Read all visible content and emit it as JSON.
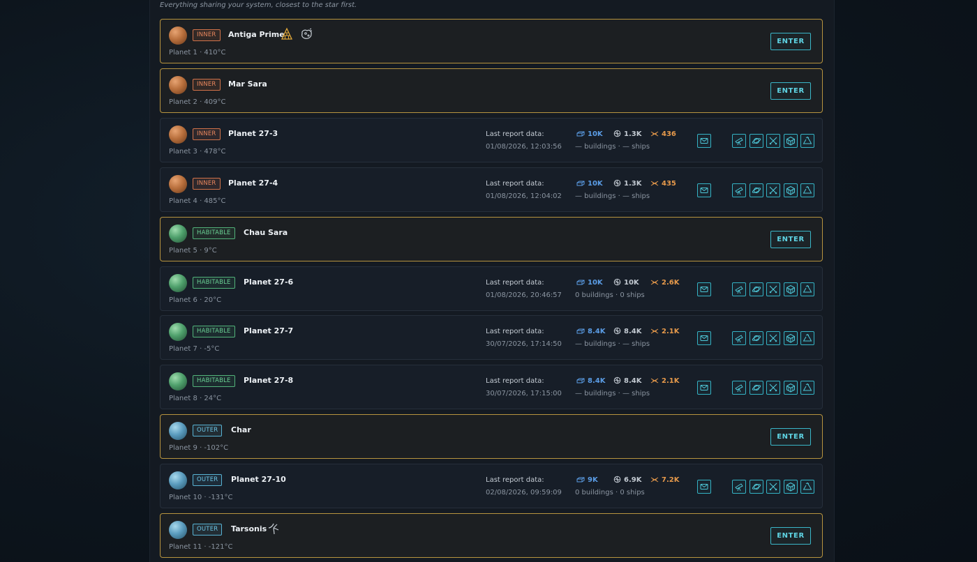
{
  "subtitle": "Everything sharing your system, closest to the star first.",
  "labels": {
    "enter": "ENTER",
    "last_report": "Last report data:"
  },
  "planets": [
    {
      "zone": "INNER",
      "name": "Antiga Prime",
      "sub": "Planet 1 · 410°C",
      "owned": true,
      "icons": [
        "pyramid-structure-icon",
        "asteroid-icon"
      ]
    },
    {
      "zone": "INNER",
      "name": "Mar Sara",
      "sub": "Planet 2 · 409°C",
      "owned": true
    },
    {
      "zone": "INNER",
      "name": "Planet 27-3",
      "sub": "Planet 3 · 478°C",
      "owned": false,
      "date": "01/08/2026, 12:03:56",
      "metal": "10K",
      "crystal": "1.3K",
      "fuel": "436",
      "bs": "— buildings · — ships"
    },
    {
      "zone": "INNER",
      "name": "Planet 27-4",
      "sub": "Planet 4 · 485°C",
      "owned": false,
      "date": "01/08/2026, 12:04:02",
      "metal": "10K",
      "crystal": "1.3K",
      "fuel": "435",
      "bs": "— buildings · — ships"
    },
    {
      "zone": "HABITABLE",
      "name": "Chau Sara",
      "sub": "Planet 5 · 9°C",
      "owned": true
    },
    {
      "zone": "HABITABLE",
      "name": "Planet 27-6",
      "sub": "Planet 6 · 20°C",
      "owned": false,
      "date": "01/08/2026, 20:46:57",
      "metal": "10K",
      "crystal": "10K",
      "fuel": "2.6K",
      "bs": "0 buildings · 0 ships"
    },
    {
      "zone": "HABITABLE",
      "name": "Planet 27-7",
      "sub": "Planet 7 · -5°C",
      "owned": false,
      "date": "30/07/2026, 17:14:50",
      "metal": "8.4K",
      "crystal": "8.4K",
      "fuel": "2.1K",
      "bs": "— buildings · — ships"
    },
    {
      "zone": "HABITABLE",
      "name": "Planet 27-8",
      "sub": "Planet 8 · 24°C",
      "owned": false,
      "date": "30/07/2026, 17:15:00",
      "metal": "8.4K",
      "crystal": "8.4K",
      "fuel": "2.1K",
      "bs": "— buildings · — ships"
    },
    {
      "zone": "OUTER",
      "name": "Char",
      "sub": "Planet 9 · -102°C",
      "owned": true
    },
    {
      "zone": "OUTER",
      "name": "Planet 27-10",
      "sub": "Planet 10 · -131°C",
      "owned": false,
      "date": "02/08/2026, 09:59:09",
      "metal": "9K",
      "crystal": "6.9K",
      "fuel": "7.2K",
      "bs": "0 buildings · 0 ships"
    },
    {
      "zone": "OUTER",
      "name": "Tarsonis",
      "sub": "Planet 11 · -121°C",
      "owned": true,
      "icons": [
        "satellite-icon"
      ]
    }
  ],
  "icon_names": {
    "message": "mail-icon",
    "actions": [
      "telescope-icon",
      "planet-ring-icon",
      "crossed-swords-icon",
      "cube-icon",
      "recycle-icon"
    ]
  },
  "colors": {
    "owned_border": "#b7943f",
    "accent": "#3ab7c9",
    "metal": "#5b9de6",
    "fuel": "#e79a4b"
  }
}
